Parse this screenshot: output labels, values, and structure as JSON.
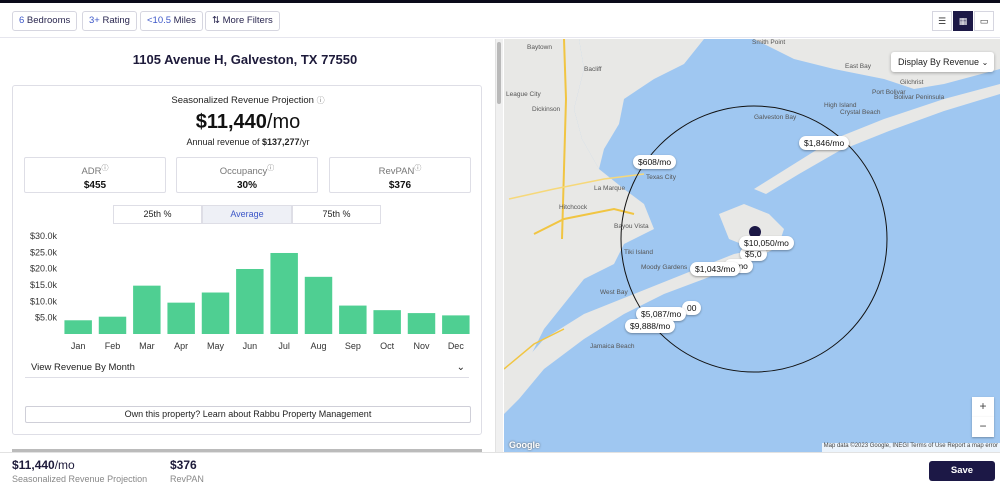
{
  "filters": {
    "bedrooms": {
      "num": "6",
      "label": " Bedrooms"
    },
    "rating": {
      "num": "3+",
      "label": " Rating"
    },
    "miles": {
      "num": "<10.5",
      "label": " Miles"
    },
    "more_filters": "More Filters"
  },
  "property": {
    "address": "1105 Avenue H, Galveston, TX 77550",
    "projection_title": "Seasonalized Revenue Projection",
    "projection_amount": "$11,440",
    "projection_unit": "/mo",
    "annual_prefix": "Annual revenue of ",
    "annual_amount": "$137,277",
    "annual_unit": "/yr",
    "stats": [
      {
        "label": "ADR",
        "value": "$455"
      },
      {
        "label": "Occupancy",
        "value": "30%"
      },
      {
        "label": "RevPAN",
        "value": "$376"
      }
    ],
    "percentile_tabs": [
      "25th %",
      "Average",
      "75th %"
    ],
    "active_tab": "Average",
    "view_by_month": "View Revenue By Month",
    "own_property": "Own this property? Learn about Rabbu Property Management"
  },
  "chart_data": {
    "type": "bar",
    "categories": [
      "Jan",
      "Feb",
      "Mar",
      "Apr",
      "May",
      "Jun",
      "Jul",
      "Aug",
      "Sep",
      "Oct",
      "Nov",
      "Dec"
    ],
    "values": [
      4200,
      5300,
      14800,
      9600,
      12700,
      19900,
      24800,
      17500,
      8700,
      7300,
      6400,
      5700
    ],
    "y_tick_labels": [
      "$5.0k",
      "$10.0k",
      "$15.0k",
      "$20.0k",
      "$25.0k",
      "$30.0k"
    ],
    "ylim": [
      0,
      30000
    ],
    "bar_color": "#4fcf92"
  },
  "map": {
    "display_by": "Display By Revenue",
    "price_tags": [
      "$608/mo",
      "$1,846/mo",
      "$10,050/mo",
      "$5,0",
      "$1,043/mo",
      "$5,087/mo",
      "$9,888/mo",
      "9/mo",
      "00"
    ],
    "places": [
      "Smith Point",
      "East Bay",
      "Baytown",
      "Bacliff",
      "Dickinson",
      "League City",
      "Texas City",
      "La Marque",
      "Hitchcock",
      "Bayou Vista",
      "Tiki Island",
      "Moody Gardens",
      "Jamaica Beach",
      "Crystal Beach",
      "Port Bolivar",
      "Gilchrist",
      "High Island",
      "Bolivar Peninsula",
      "Galveston Bay",
      "West Bay"
    ],
    "attribution": "Map data ©2023 Google, INEGI   Terms of Use   Report a map error",
    "google": "Google",
    "zoom_in": "+",
    "zoom_out": "−"
  },
  "footer": {
    "projection_amount": "$11,440",
    "projection_unit": "/mo",
    "projection_label": "Seasonalized Revenue Projection",
    "revpan_amount": "$376",
    "revpan_label": "RevPAN",
    "save": "Save"
  },
  "colors": {
    "brand": "#1c1846",
    "accent": "#3d57c8",
    "bar": "#4fcf92",
    "water": "#9fc7f1",
    "land": "#e8e8e6"
  }
}
